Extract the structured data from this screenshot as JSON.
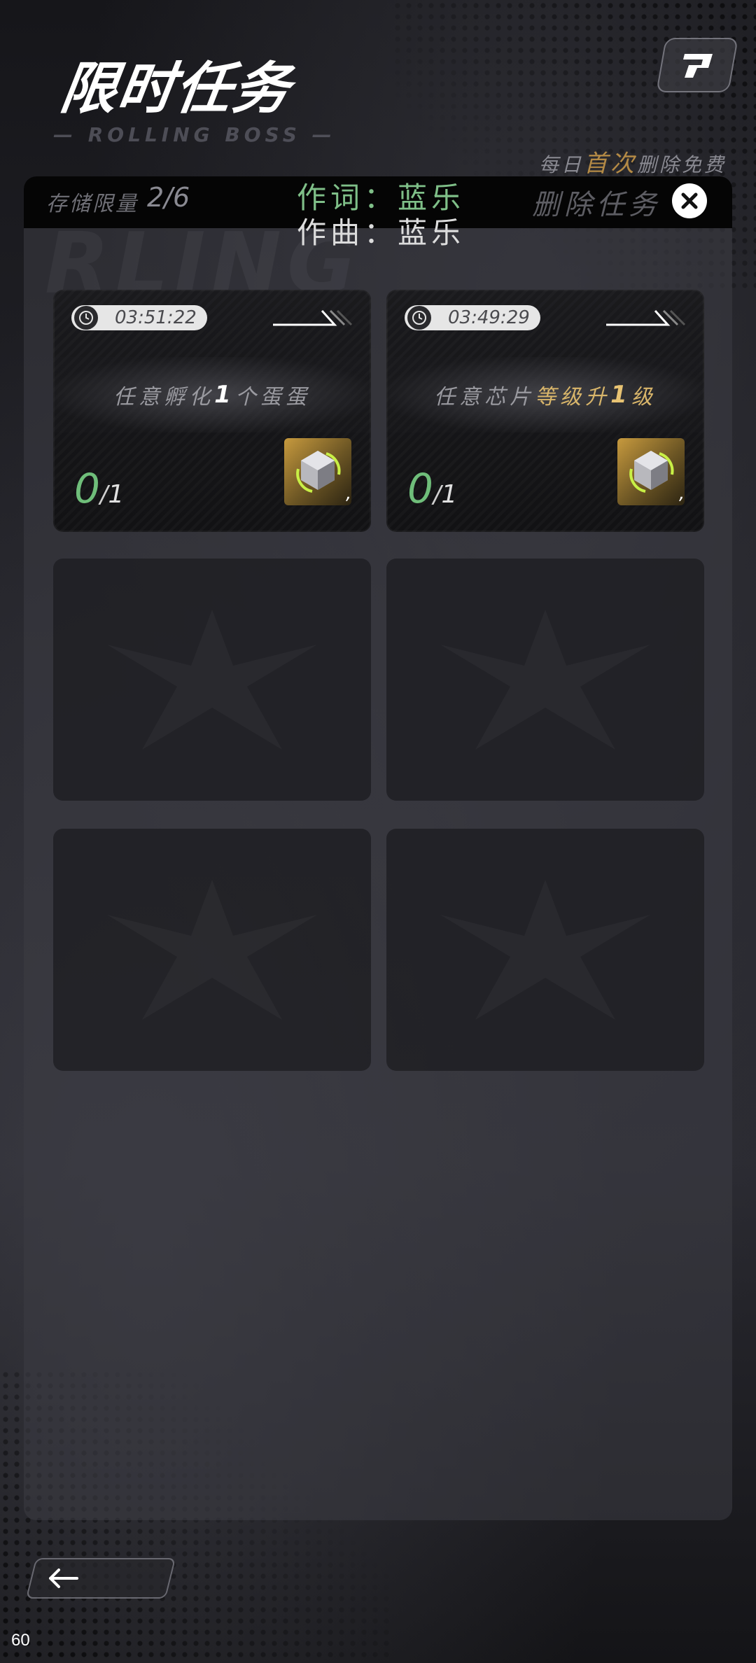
{
  "header": {
    "title": "限时任务",
    "subtitle": "— ROLLING BOSS —",
    "daily_note_pre": "每日",
    "daily_note_highlight": "首次",
    "daily_note_post": "删除免费"
  },
  "panel": {
    "storage_label": "存储限量",
    "storage_count": "2/6",
    "lyrics_line1": "作词：蓝乐",
    "lyrics_line2": "作曲：蓝乐",
    "delete_label": "删除任务"
  },
  "cards": [
    {
      "timer": "03:51:22",
      "task_pre": "任意孵化",
      "task_num": "1",
      "task_post": "个蛋蛋",
      "progress_current": "0",
      "progress_total": "1",
      "reward_mark": ","
    },
    {
      "timer": "03:49:29",
      "task_pre": "任意芯片",
      "task_gold": "等级升",
      "task_num": "1",
      "task_post": "级",
      "progress_current": "0",
      "progress_total": "1",
      "reward_mark": ","
    }
  ],
  "empty_slots": 4,
  "footer": {
    "fps": "60"
  },
  "colors": {
    "progress_green": "#6fbe7a",
    "gold_accent": "#d8b56a",
    "lyrics_green": "#7fbf88"
  },
  "icons": [
    "emblem-icon",
    "close-icon",
    "timer-icon",
    "double-arrow-icon",
    "reward-cube-icon",
    "placeholder-crest-icon",
    "back-arrow-icon"
  ]
}
